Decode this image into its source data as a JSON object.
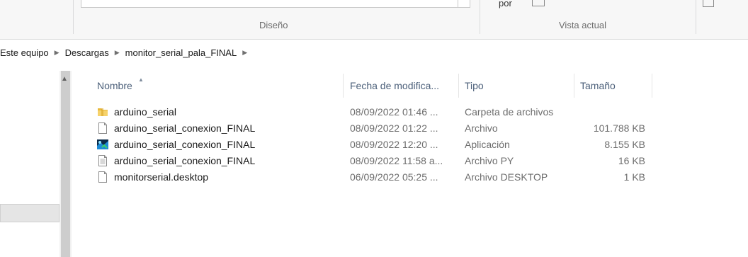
{
  "ribbon": {
    "groups": [
      {
        "label": "Diseño"
      },
      {
        "label": "Vista actual"
      }
    ],
    "partial_text": "por"
  },
  "breadcrumb": {
    "items": [
      "Este equipo",
      "Descargas",
      "monitor_serial_pala_FINAL"
    ]
  },
  "columns": {
    "name": "Nombre",
    "date": "Fecha de modifica...",
    "type": "Tipo",
    "size": "Tamaño"
  },
  "files": [
    {
      "name": "arduino_serial",
      "date": "08/09/2022 01:46 ...",
      "type": "Carpeta de archivos",
      "size": "",
      "icon": "folder-icon"
    },
    {
      "name": "arduino_serial_conexion_FINAL",
      "date": "08/09/2022 01:22 ...",
      "type": "Archivo",
      "size": "101.788 KB",
      "icon": "file-icon"
    },
    {
      "name": "arduino_serial_conexion_FINAL",
      "date": "08/09/2022 12:20 ...",
      "type": "Aplicación",
      "size": "8.155 KB",
      "icon": "application-icon"
    },
    {
      "name": "arduino_serial_conexion_FINAL",
      "date": "08/09/2022 11:58 a...",
      "type": "Archivo PY",
      "size": "16 KB",
      "icon": "text-file-icon"
    },
    {
      "name": "monitorserial.desktop",
      "date": "06/09/2022 05:25 ...",
      "type": "Archivo DESKTOP",
      "size": "1 KB",
      "icon": "file-icon"
    }
  ],
  "colors": {
    "header_text": "#4c607a",
    "folder": "#e8b93b",
    "selection_border": "#dadbdc"
  }
}
